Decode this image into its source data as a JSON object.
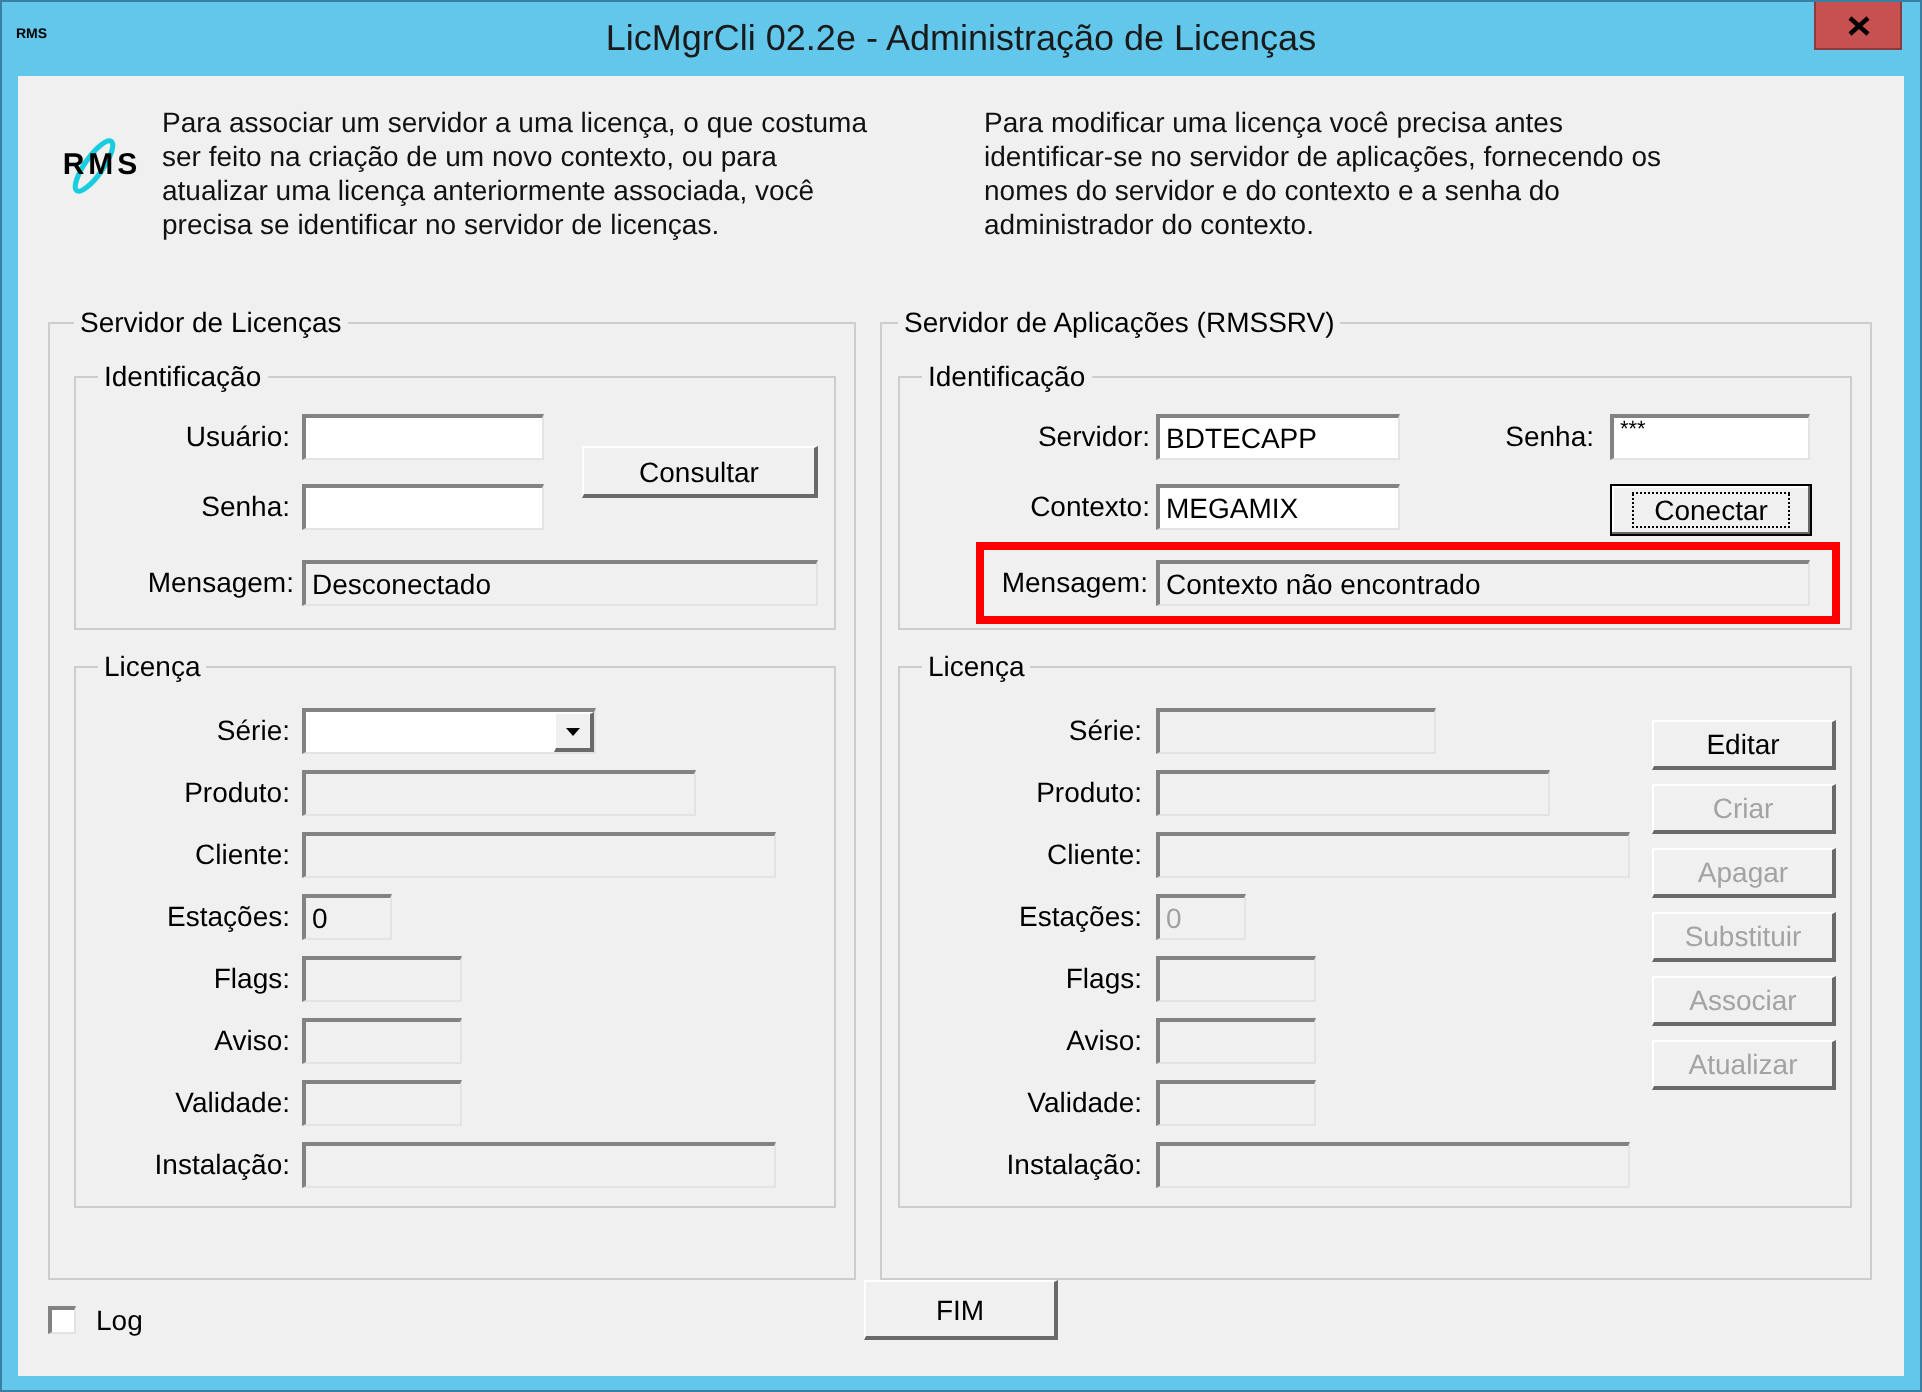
{
  "window": {
    "icon_text": "RMS",
    "title": "LicMgrCli 02.2e - Administração de Licenças"
  },
  "intro": {
    "logo_text": "RMS",
    "texts": [
      "Para associar um servidor a uma licença, o que costuma\nser feito na criação de um novo contexto, ou para\natualizar uma licença anteriormente associada, você\nprecisa se identificar no servidor de licenças.",
      "Para modificar uma licença você precisa antes\nidentificar-se no servidor de aplicações, fornecendo os\nnomes do servidor e do contexto e a senha do\nadministrador do contexto."
    ]
  },
  "groups": [
    {
      "title": "Servidor de Licenças",
      "identification": {
        "title": "Identificação",
        "fields": [
          {
            "label": "Usuário:",
            "kind": "edit"
          },
          {
            "label": "Senha:",
            "kind": "edit"
          }
        ],
        "button": {
          "label": "Consultar",
          "focused": false
        },
        "message": {
          "label": "Mensagem:",
          "value": "Desconectado",
          "highlighted": false
        }
      },
      "license": {
        "title": "Licença",
        "disabled": false,
        "fields": [
          {
            "label": "Série:",
            "kind": "combo"
          },
          {
            "label": "Produto:",
            "kind": "readonly"
          },
          {
            "label": "Cliente:",
            "kind": "readonly"
          },
          {
            "label": "Estações:",
            "kind": "readonly",
            "value": "0"
          },
          {
            "label": "Flags:",
            "kind": "readonly"
          },
          {
            "label": "Aviso:",
            "kind": "readonly"
          },
          {
            "label": "Validade:",
            "kind": "readonly"
          },
          {
            "label": "Instalação:",
            "kind": "readonly"
          }
        ]
      }
    },
    {
      "title": "Servidor de Aplicações (RMSSRV)",
      "identification": {
        "title": "Identificação",
        "fields": [
          {
            "label": "Servidor:",
            "kind": "edit",
            "value": "BDTECAPP"
          },
          {
            "label": "Senha:",
            "kind": "password",
            "value": "***"
          },
          {
            "label": "Contexto:",
            "kind": "edit",
            "value": "MEGAMIX"
          }
        ],
        "button": {
          "label": "Conectar",
          "focused": true
        },
        "message": {
          "label": "Mensagem:",
          "value": "Contexto não encontrado",
          "highlighted": true
        }
      },
      "license": {
        "title": "Licença",
        "disabled": true,
        "fields": [
          {
            "label": "Série:",
            "kind": "readonly"
          },
          {
            "label": "Produto:",
            "kind": "readonly"
          },
          {
            "label": "Cliente:",
            "kind": "readonly"
          },
          {
            "label": "Estações:",
            "kind": "readonly",
            "value": "0"
          },
          {
            "label": "Flags:",
            "kind": "readonly"
          },
          {
            "label": "Aviso:",
            "kind": "readonly"
          },
          {
            "label": "Validade:",
            "kind": "readonly"
          },
          {
            "label": "Instalação:",
            "kind": "readonly"
          }
        ],
        "buttons": [
          {
            "label": "Editar",
            "disabled": false
          },
          {
            "label": "Criar",
            "disabled": true
          },
          {
            "label": "Apagar",
            "disabled": true
          },
          {
            "label": "Substituir",
            "disabled": true
          },
          {
            "label": "Associar",
            "disabled": true
          },
          {
            "label": "Atualizar",
            "disabled": true
          }
        ]
      }
    }
  ],
  "log": {
    "label": "Log",
    "checked": false
  },
  "exit_button": {
    "label": "FIM"
  }
}
